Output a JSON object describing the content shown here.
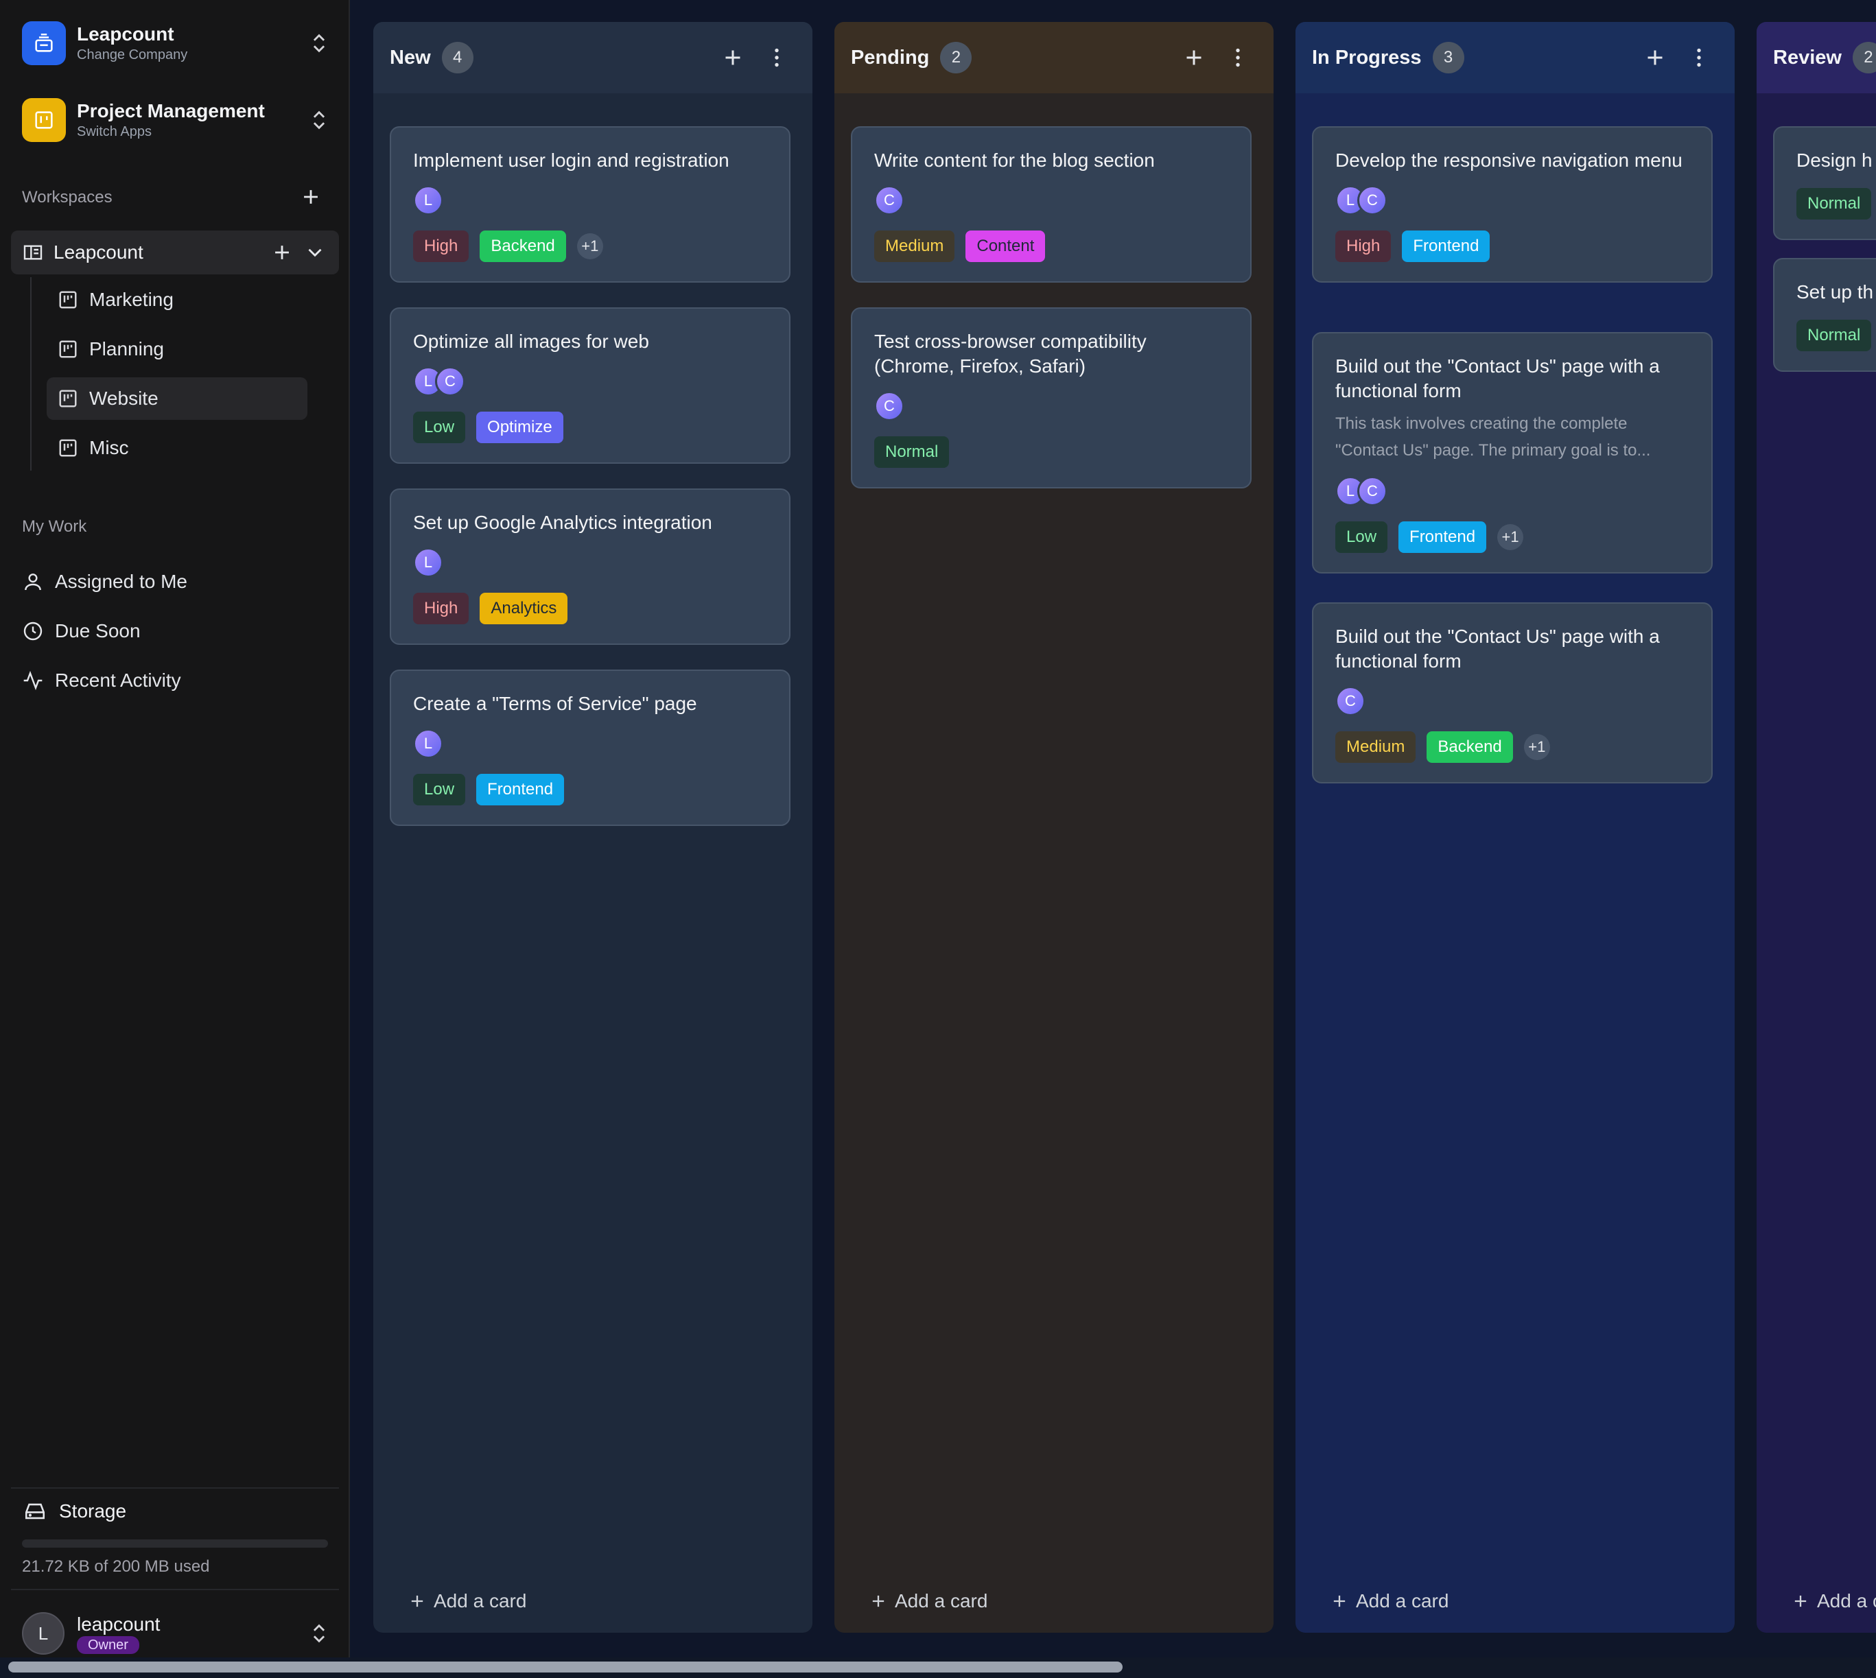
{
  "sidebar": {
    "company": {
      "name": "Leapcount",
      "subtitle": "Change Company"
    },
    "app": {
      "name": "Project Management",
      "subtitle": "Switch Apps"
    },
    "workspaces_label": "Workspaces",
    "workspace": {
      "name": "Leapcount"
    },
    "boards": [
      {
        "label": "Marketing"
      },
      {
        "label": "Planning"
      },
      {
        "label": "Website",
        "active": true
      },
      {
        "label": "Misc"
      }
    ],
    "my_work_label": "My Work",
    "my_work": [
      {
        "label": "Assigned to Me",
        "icon": "user-icon"
      },
      {
        "label": "Due Soon",
        "icon": "clock-icon"
      },
      {
        "label": "Recent Activity",
        "icon": "activity-icon"
      }
    ],
    "storage": {
      "label": "Storage",
      "used_text": "21.72 KB of 200 MB used",
      "used_fraction": 0.0001
    },
    "user": {
      "initial": "L",
      "name": "leapcount",
      "role": "Owner"
    }
  },
  "colors": {
    "company_tile": "#2563eb",
    "app_tile": "#eab308",
    "col_new": "#1e293b",
    "col_pending": "#292524",
    "col_progress": "#172554",
    "col_review": "#1e1b4b"
  },
  "columns": [
    {
      "title": "New",
      "count": "4",
      "add_label": "Add a card",
      "cards": [
        {
          "title": "Implement user login and registration",
          "avatars": [
            "L"
          ],
          "priority": "High",
          "label": "Backend",
          "extra": "+1"
        },
        {
          "title": "Optimize all images for web",
          "avatars": [
            "L",
            "C"
          ],
          "priority": "Low",
          "label": "Optimize"
        },
        {
          "title": "Set up Google Analytics integration",
          "avatars": [
            "L"
          ],
          "priority": "High",
          "label": "Analytics"
        },
        {
          "title": "Create a \"Terms of Service\" page",
          "avatars": [
            "L"
          ],
          "priority": "Low",
          "label": "Frontend"
        }
      ]
    },
    {
      "title": "Pending",
      "count": "2",
      "add_label": "Add a card",
      "cards": [
        {
          "title": "Write content for the blog section",
          "avatars": [
            "C"
          ],
          "priority": "Medium",
          "label": "Content"
        },
        {
          "title": "Test cross-browser compatibility (Chrome, Firefox, Safari)",
          "avatars": [
            "C"
          ],
          "priority": "Normal"
        }
      ]
    },
    {
      "title": "In Progress",
      "count": "3",
      "add_label": "Add a card",
      "cards": [
        {
          "title": "Develop the responsive navigation menu",
          "avatars": [
            "L",
            "C"
          ],
          "priority": "High",
          "label": "Frontend"
        },
        {
          "title": "Build out the \"Contact Us\" page with a functional form",
          "description": "This task involves creating the complete \"Contact Us\" page. The primary goal is to...",
          "avatars": [
            "L",
            "C"
          ],
          "priority": "Low",
          "label": "Frontend",
          "extra": "+1"
        },
        {
          "title": "Build out the \"Contact Us\" page with a functional form",
          "avatars": [
            "C"
          ],
          "priority": "Medium",
          "label": "Backend",
          "extra": "+1"
        }
      ]
    },
    {
      "title": "Review",
      "count": "2",
      "add_label": "Add a card",
      "cards": [
        {
          "title": "Design h",
          "priority": "Normal"
        },
        {
          "title": "Set up th",
          "priority": "Normal"
        }
      ]
    }
  ],
  "priority_styles": {
    "High": {
      "bg": "#4a2b3a",
      "fg": "#fca5a5"
    },
    "Low": {
      "bg": "#1e3a34",
      "fg": "#86efac"
    },
    "Medium": {
      "bg": "#3f3a2e",
      "fg": "#fcd34d"
    },
    "Normal": {
      "bg": "#1e3a34",
      "fg": "#86efac"
    }
  },
  "label_styles": {
    "Backend": {
      "bg": "#22c55e",
      "fg": "#ffffff"
    },
    "Frontend": {
      "bg": "#0ea5e9",
      "fg": "#ffffff"
    },
    "Optimize": {
      "bg": "#6366f1",
      "fg": "#ffffff"
    },
    "Analytics": {
      "bg": "#eab308",
      "fg": "#1f2937"
    },
    "Content": {
      "bg": "#d946ef",
      "fg": "#1f2937"
    }
  }
}
